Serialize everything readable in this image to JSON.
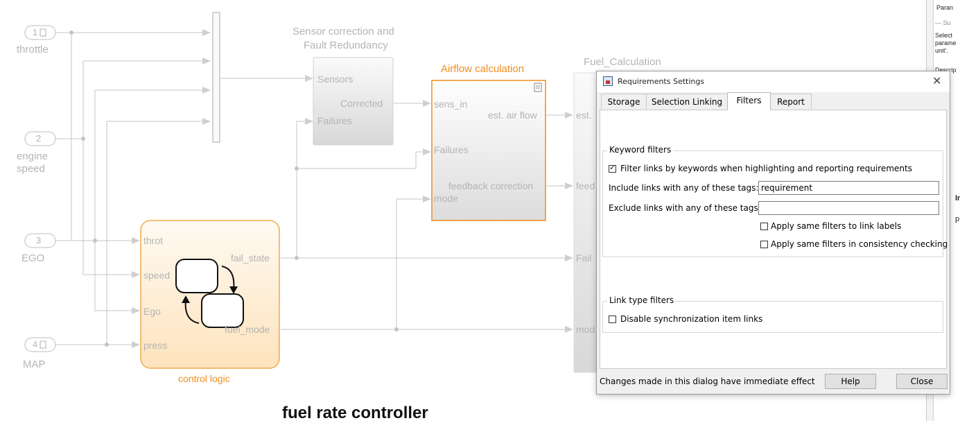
{
  "diagram": {
    "inports": [
      {
        "num": "1",
        "label": "throttle"
      },
      {
        "num": "2",
        "label": "engine\nspeed"
      },
      {
        "num": "3",
        "label": "EGO"
      },
      {
        "num": "4",
        "label": "MAP"
      }
    ],
    "sensor_block": {
      "title_line1": "Sensor correction and",
      "title_line2": "Fault Redundancy",
      "port_in_sensors": "Sensors",
      "port_in_failures": "Failures",
      "port_out_corrected": "Corrected"
    },
    "airflow_block": {
      "title": "Airflow calculation",
      "port_in_sens": "sens_in",
      "port_in_failures": "Failures",
      "port_in_mode": "mode",
      "port_out_air": "est. air flow",
      "port_out_feedback": "feedback correction"
    },
    "fuel_block": {
      "title": "Fuel_Calculation",
      "port_est": "est.",
      "port_feed": "feed",
      "port_fail": "Fail",
      "port_mod": "mod"
    },
    "control_block": {
      "title": "control logic",
      "port_throt": "throt",
      "port_speed": "speed",
      "port_ego": "Ego",
      "port_press": "press",
      "port_fail_state": "fail_state",
      "port_fuel_mode": "fuel_mode"
    },
    "subsystem_title": "fuel rate controller",
    "accent_color": "#f08c1c",
    "faded_color": "#b4b4b4"
  },
  "right_panel": {
    "lines": [
      "Paran",
      "— Su",
      "Select",
      "parame",
      "unit'.",
      "Descrip",
      "In",
      "p l"
    ]
  },
  "dialog": {
    "title": "Requirements Settings",
    "close_glyph": "✕",
    "tabs": [
      "Storage",
      "Selection Linking",
      "Filters",
      "Report"
    ],
    "active_tab": "Filters",
    "keyword_group": {
      "legend": "Keyword filters",
      "filter_checkbox_label": "Filter links by keywords when highlighting and reporting requirements",
      "filter_checked": true,
      "include_label": "Include links with any of these tags:",
      "include_value": "requirement",
      "exclude_label": "Exclude links with any of these tags:",
      "exclude_value": "",
      "apply_labels_label": "Apply same filters to link labels",
      "apply_labels_checked": false,
      "apply_consistency_label": "Apply same filters in consistency checking",
      "apply_consistency_checked": false
    },
    "link_type_group": {
      "legend": "Link type filters",
      "disable_sync_label": "Disable synchronization item links",
      "disable_sync_checked": false
    },
    "footer_text": "Changes made in this dialog have immediate effect",
    "help_label": "Help",
    "close_label": "Close"
  }
}
